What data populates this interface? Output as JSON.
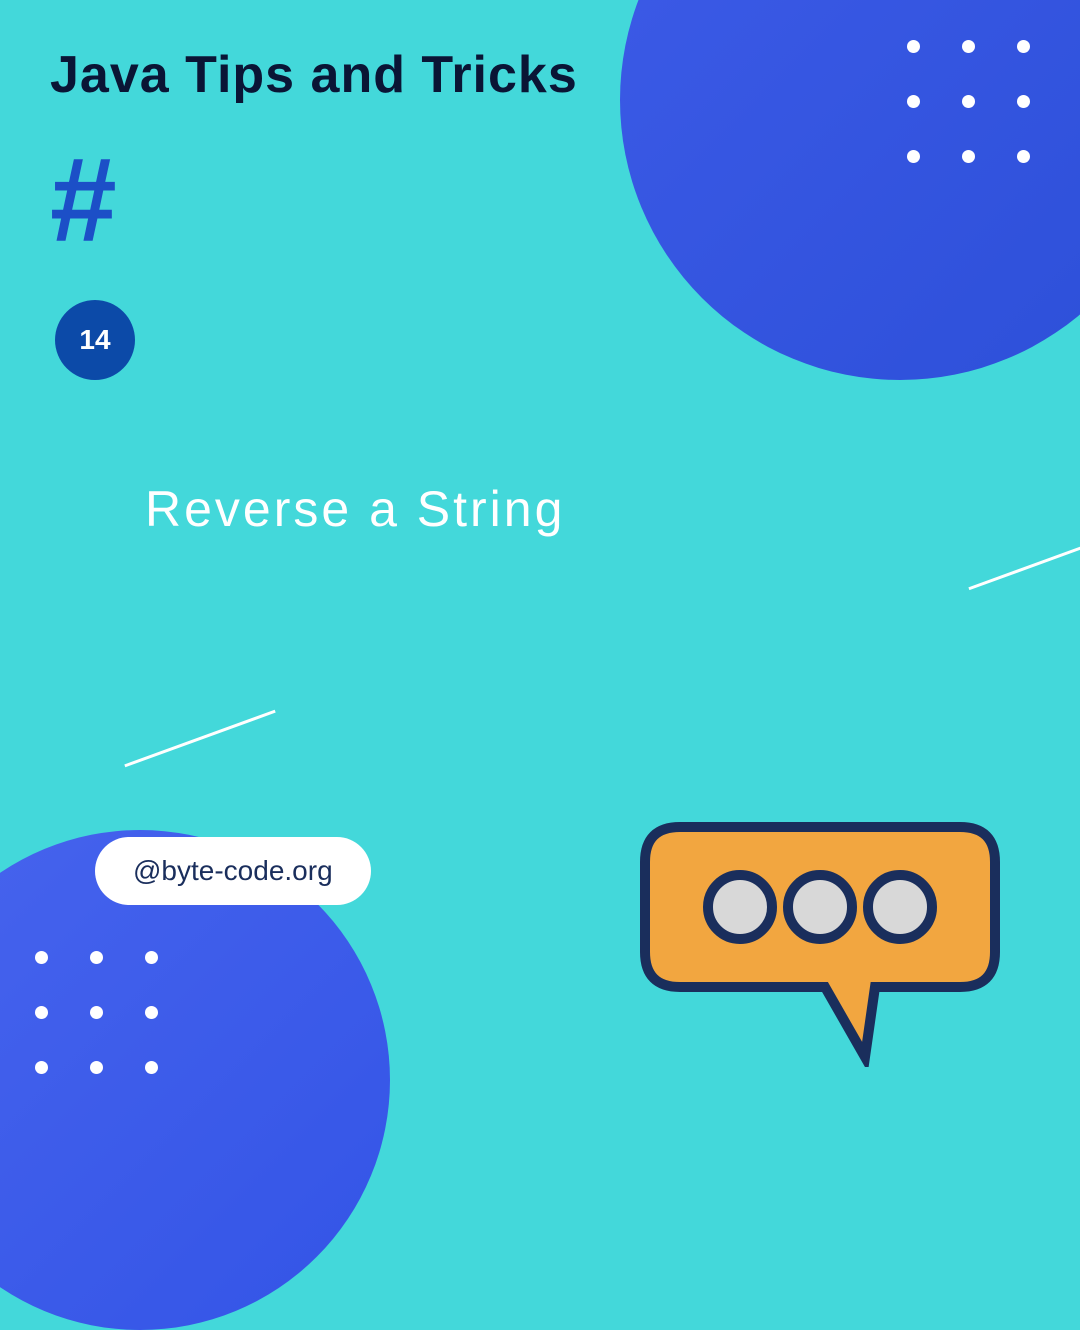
{
  "title": "Java Tips and Tricks",
  "tipNumber": "14",
  "tipTitle": "Reverse a String",
  "handle": "@byte-code.org",
  "colors": {
    "background": "#43d8da",
    "circleBlue": "#3d5be8",
    "darkBlue": "#0c4aa8",
    "textDark": "#0a1535",
    "orange": "#f2a640",
    "bubbleOutline": "#1a2e5c"
  }
}
